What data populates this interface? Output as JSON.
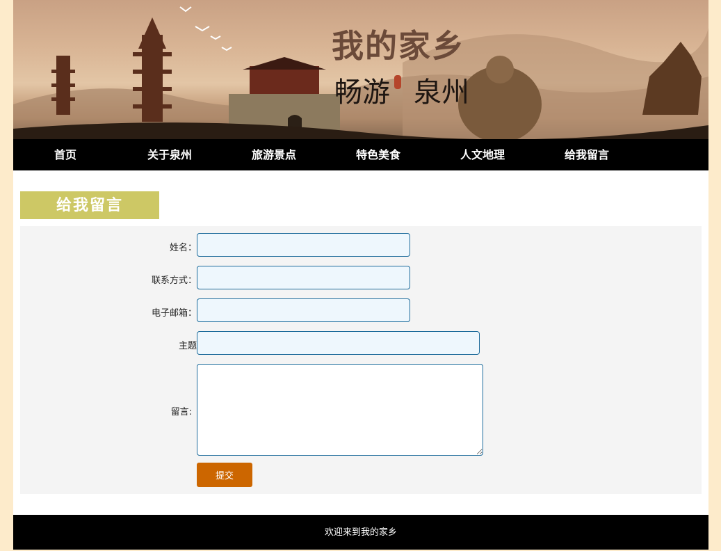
{
  "banner": {
    "title": "我的家乡",
    "subtitle_left": "畅游",
    "subtitle_right": "泉州"
  },
  "nav": {
    "items": [
      {
        "label": "首页"
      },
      {
        "label": "关于泉州"
      },
      {
        "label": "旅游景点"
      },
      {
        "label": "特色美食"
      },
      {
        "label": "人文地理"
      },
      {
        "label": "给我留言"
      }
    ]
  },
  "section": {
    "title": "给我留言"
  },
  "form": {
    "name_label": "姓名：",
    "name_value": "",
    "contact_label": "联系方式：",
    "contact_value": "",
    "email_label": "电子邮箱：",
    "email_value": "",
    "subject_label": "主题",
    "subject_value": "",
    "message_label": "留言:",
    "message_value": "",
    "submit_label": "提交"
  },
  "footer": {
    "text": "欢迎来到我的家乡"
  },
  "colors": {
    "page_bg": "#fdebcb",
    "nav_bg": "#000000",
    "section_title_bg": "#cdc865",
    "panel_bg": "#f4f4f4",
    "input_border": "#1b6a9a",
    "input_bg": "#eef7fd",
    "submit_bg": "#cc6600"
  }
}
